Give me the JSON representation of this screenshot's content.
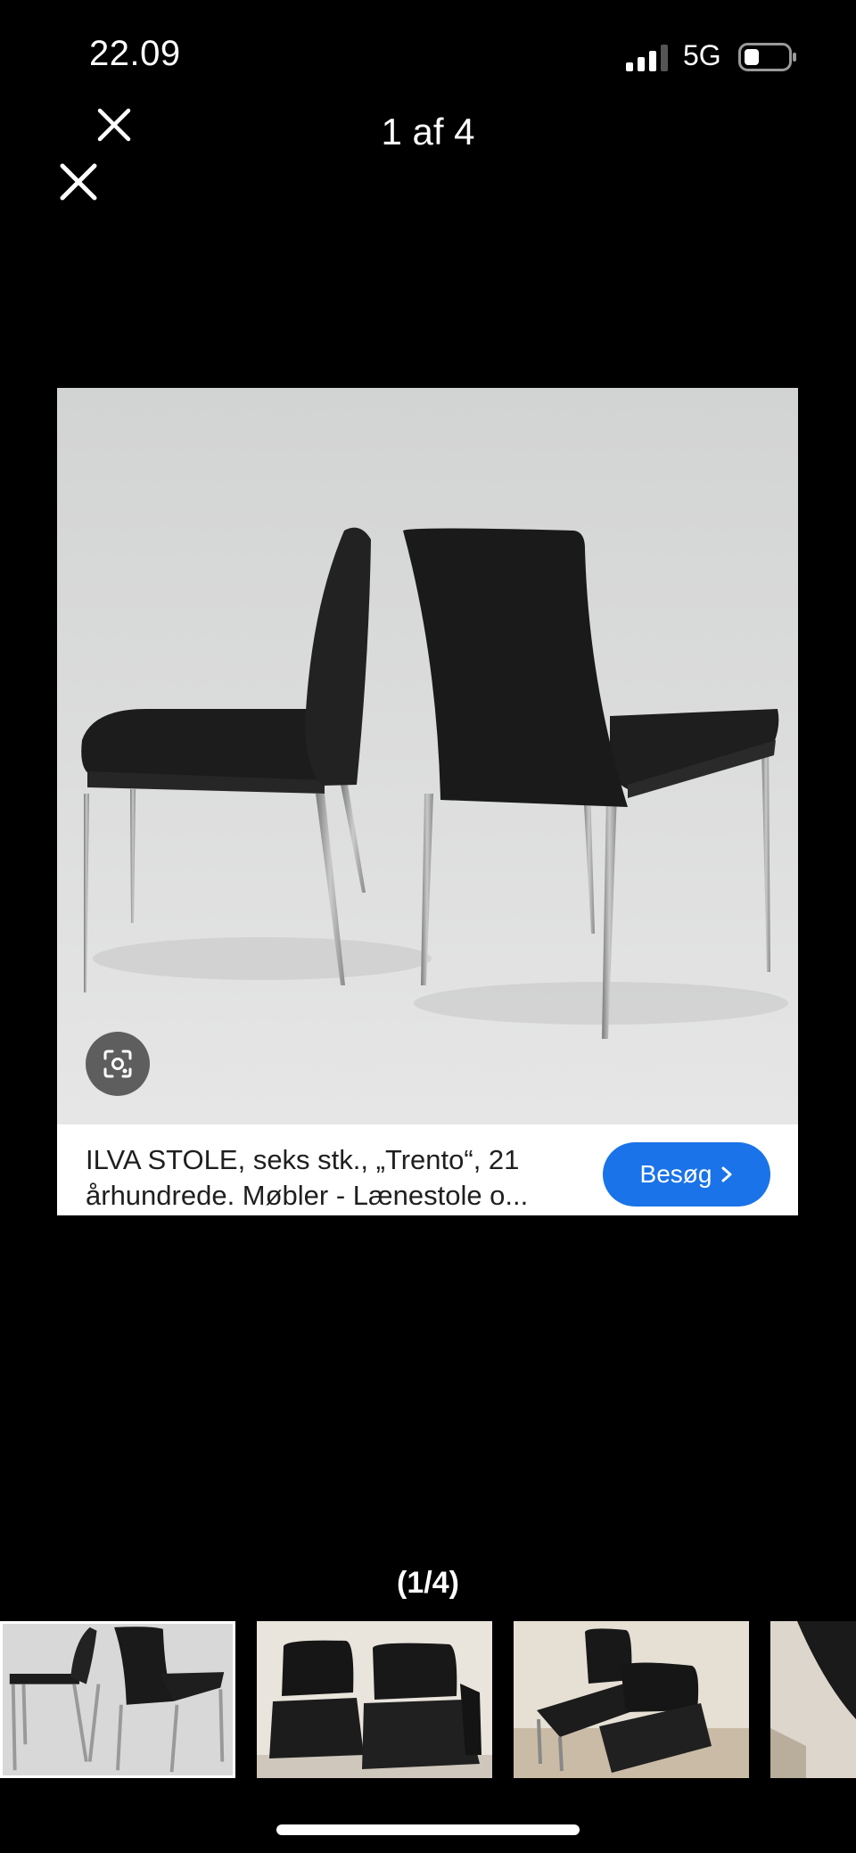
{
  "status_bar": {
    "time": "22.09",
    "network": "5G",
    "icons": [
      "signal-icon",
      "battery-icon"
    ]
  },
  "header": {
    "counter": "1 af 4",
    "icons": [
      "close-icon"
    ]
  },
  "viewer": {
    "caption": "ILVA STOLE, seks stk., „Trento“, 21 århundrede. Møbler - Lænestole o...",
    "visit_label": "Besøg",
    "icons": [
      "lens-icon",
      "chevron-right-icon"
    ],
    "accent_color": "#1a73e8"
  },
  "pager": {
    "index": "(1/4)",
    "thumbnail_count": 4,
    "selected_thumbnail": 1
  }
}
